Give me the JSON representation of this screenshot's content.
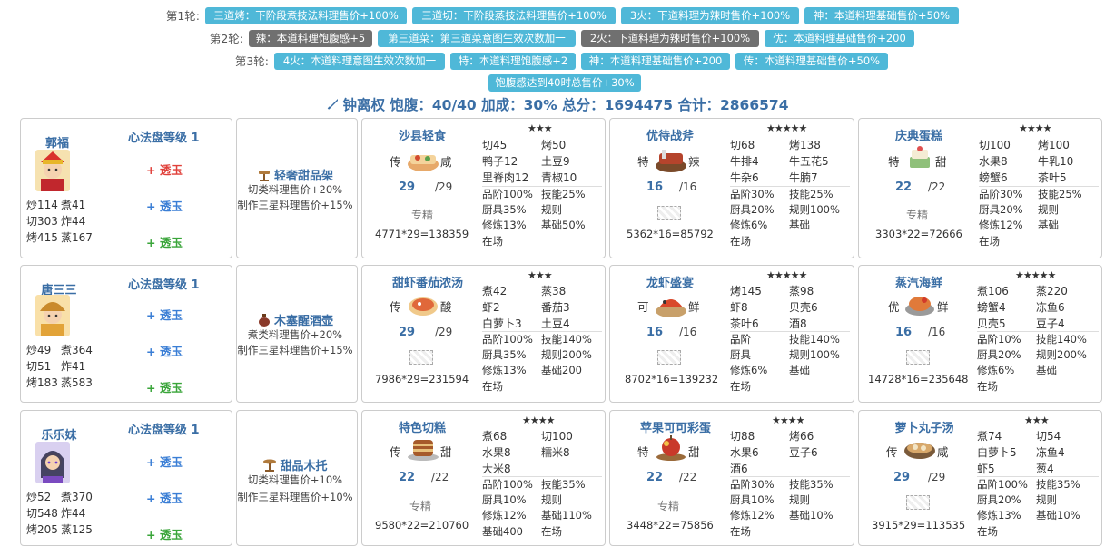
{
  "rounds": [
    {
      "label": "第1轮:",
      "tags": [
        {
          "text": "三道烤：下阶段煮技法料理售价+100%",
          "dark": false
        },
        {
          "text": "三道切：下阶段蒸技法料理售价+100%",
          "dark": false
        },
        {
          "text": "3火：下道料理为辣时售价+100%",
          "dark": false
        },
        {
          "text": "神：本道料理基础售价+50%",
          "dark": false
        }
      ]
    },
    {
      "label": "第2轮:",
      "tags": [
        {
          "text": "辣：本道料理饱腹感+5",
          "dark": true
        },
        {
          "text": "第三道菜：第三道菜意图生效次数加一",
          "dark": false
        },
        {
          "text": "2火：下道料理为辣时售价+100%",
          "dark": true
        },
        {
          "text": "优：本道料理基础售价+200",
          "dark": false
        }
      ]
    },
    {
      "label": "第3轮:",
      "tags": [
        {
          "text": "4火：本道料理意图生效次数加一",
          "dark": false
        },
        {
          "text": "特：本道料理饱腹感+2",
          "dark": false
        },
        {
          "text": "神：本道料理基础售价+200",
          "dark": false
        },
        {
          "text": "传：本道料理基础售价+50%",
          "dark": false
        }
      ]
    },
    {
      "label": "",
      "tags": [
        {
          "text": "饱腹感达到40时总售价+30%",
          "dark": false
        }
      ]
    }
  ],
  "summary": {
    "icon": "knife-icon",
    "text": "钟离权 饱腹：40/40 加成：30% 总分：1694475 合计：2866574"
  },
  "chefs": [
    {
      "name": "郭福",
      "heart_label": "心法盘等级 1",
      "jades": [
        {
          "label": "+ 透玉",
          "color": "#e0403a"
        },
        {
          "label": "+ 透玉",
          "color": "#3a7ed5"
        },
        {
          "label": "+ 透玉",
          "color": "#3aa53a"
        }
      ],
      "stats": [
        [
          "炒114",
          "煮41"
        ],
        [
          "切303",
          "炸44"
        ],
        [
          "烤415",
          "蒸167"
        ]
      ],
      "equip": {
        "name": "轻奢甜品架",
        "icon": "dessert-stand-icon",
        "effects": [
          "切类料理售价+20%",
          "制作三星料理售价+15%"
        ]
      },
      "recipes": [
        {
          "name": "沙县轻食",
          "stars": "★★★",
          "rank": "传",
          "taste": "咸",
          "qty": "29",
          "qty_max": "/29",
          "chef_label": "专精",
          "calc": "4771*29=138359",
          "mats": [
            [
              "切45",
              "烤50"
            ],
            [
              "鸭子12",
              "土豆9"
            ],
            [
              "里脊肉12",
              "青椒10"
            ]
          ],
          "grid": [
            [
              "品阶100%",
              "技能25%"
            ],
            [
              "厨具35%",
              "规则"
            ],
            [
              "修炼13%",
              "基础50%"
            ],
            [
              "在场",
              ""
            ]
          ]
        },
        {
          "name": "优待战斧",
          "stars": "★★★★★",
          "rank": "特",
          "taste": "辣",
          "qty": "16",
          "qty_max": "/16",
          "chef_label": "",
          "calc": "5362*16=85792",
          "mats": [
            [
              "切68",
              "烤138"
            ],
            [
              "牛排4",
              "牛五花5"
            ],
            [
              "牛杂6",
              "牛腩7"
            ]
          ],
          "grid": [
            [
              "品阶30%",
              "技能25%"
            ],
            [
              "厨具20%",
              "规则100%"
            ],
            [
              "修炼6%",
              "基础"
            ],
            [
              "在场",
              ""
            ]
          ]
        },
        {
          "name": "庆典蛋糕",
          "stars": "★★★★",
          "rank": "特",
          "taste": "甜",
          "qty": "22",
          "qty_max": "/22",
          "chef_label": "专精",
          "calc": "3303*22=72666",
          "mats": [
            [
              "切100",
              "烤100"
            ],
            [
              "水果8",
              "牛乳10"
            ],
            [
              "螃蟹6",
              "茶叶5"
            ]
          ],
          "grid": [
            [
              "品阶30%",
              "技能25%"
            ],
            [
              "厨具20%",
              "规则"
            ],
            [
              "修炼12%",
              "基础"
            ],
            [
              "在场",
              ""
            ]
          ]
        }
      ]
    },
    {
      "name": "唐三三",
      "heart_label": "心法盘等级 1",
      "jades": [
        {
          "label": "+ 透玉",
          "color": "#3a7ed5"
        },
        {
          "label": "+ 透玉",
          "color": "#3a7ed5"
        },
        {
          "label": "+ 透玉",
          "color": "#3aa53a"
        }
      ],
      "stats": [
        [
          "炒49",
          "煮364"
        ],
        [
          "切51",
          "炸41"
        ],
        [
          "烤183",
          "蒸583"
        ]
      ],
      "equip": {
        "name": "木塞醒酒壶",
        "icon": "wine-decanter-icon",
        "effects": [
          "煮类料理售价+20%",
          "制作三星料理售价+15%"
        ]
      },
      "recipes": [
        {
          "name": "甜虾番茄浓汤",
          "stars": "★★★",
          "rank": "传",
          "taste": "酸",
          "qty": "29",
          "qty_max": "/29",
          "chef_label": "",
          "calc": "7986*29=231594",
          "mats": [
            [
              "煮42",
              "蒸38"
            ],
            [
              "虾2",
              "番茄3"
            ],
            [
              "白萝卜3",
              "土豆4"
            ]
          ],
          "grid": [
            [
              "品阶100%",
              "技能140%"
            ],
            [
              "厨具35%",
              "规则200%"
            ],
            [
              "修炼13%",
              "基础200"
            ],
            [
              "在场",
              ""
            ]
          ]
        },
        {
          "name": "龙虾盛宴",
          "stars": "★★★★★",
          "rank": "可",
          "taste": "鲜",
          "qty": "16",
          "qty_max": "/16",
          "chef_label": "",
          "calc": "8702*16=139232",
          "mats": [
            [
              "烤145",
              "蒸98"
            ],
            [
              "虾8",
              "贝壳6"
            ],
            [
              "茶叶6",
              "酒8"
            ]
          ],
          "grid": [
            [
              "品阶",
              "技能140%"
            ],
            [
              "厨具",
              "规则100%"
            ],
            [
              "修炼6%",
              "基础"
            ],
            [
              "在场",
              ""
            ]
          ]
        },
        {
          "name": "蒸汽海鲜",
          "stars": "★★★★★",
          "rank": "优",
          "taste": "鲜",
          "qty": "16",
          "qty_max": "/16",
          "chef_label": "",
          "calc": "14728*16=235648",
          "mats": [
            [
              "煮106",
              "蒸220"
            ],
            [
              "螃蟹4",
              "冻鱼6"
            ],
            [
              "贝壳5",
              "豆子4"
            ]
          ],
          "grid": [
            [
              "品阶10%",
              "技能140%"
            ],
            [
              "厨具20%",
              "规则200%"
            ],
            [
              "修炼6%",
              "基础"
            ],
            [
              "在场",
              ""
            ]
          ]
        }
      ]
    },
    {
      "name": "乐乐妹",
      "heart_label": "心法盘等级 1",
      "jades": [
        {
          "label": "+ 透玉",
          "color": "#3a7ed5"
        },
        {
          "label": "+ 透玉",
          "color": "#3a7ed5"
        },
        {
          "label": "+ 透玉",
          "color": "#3aa53a"
        }
      ],
      "stats": [
        [
          "炒52",
          "煮370"
        ],
        [
          "切548",
          "炸44"
        ],
        [
          "烤205",
          "蒸125"
        ]
      ],
      "equip": {
        "name": "甜品木托",
        "icon": "wooden-tray-icon",
        "effects": [
          "切类料理售价+10%",
          "制作三星料理售价+10%"
        ]
      },
      "recipes": [
        {
          "name": "特色切糕",
          "stars": "★★★★",
          "rank": "传",
          "taste": "甜",
          "qty": "22",
          "qty_max": "/22",
          "chef_label": "专精",
          "calc": "9580*22=210760",
          "mats": [
            [
              "煮68",
              "切100"
            ],
            [
              "水果8",
              "糯米8"
            ],
            [
              "大米8",
              ""
            ]
          ],
          "grid": [
            [
              "品阶100%",
              "技能35%"
            ],
            [
              "厨具10%",
              "规则"
            ],
            [
              "修炼12%",
              "基础110%"
            ],
            [
              "基础400",
              "在场"
            ]
          ]
        },
        {
          "name": "苹果可可彩蛋",
          "stars": "★★★★",
          "rank": "特",
          "taste": "甜",
          "qty": "22",
          "qty_max": "/22",
          "chef_label": "专精",
          "calc": "3448*22=75856",
          "mats": [
            [
              "切88",
              "烤66"
            ],
            [
              "水果6",
              "豆子6"
            ],
            [
              "酒6",
              ""
            ]
          ],
          "grid": [
            [
              "品阶30%",
              "技能35%"
            ],
            [
              "厨具10%",
              "规则"
            ],
            [
              "修炼12%",
              "基础10%"
            ],
            [
              "在场",
              ""
            ]
          ]
        },
        {
          "name": "萝卜丸子汤",
          "stars": "★★★",
          "rank": "传",
          "taste": "咸",
          "qty": "29",
          "qty_max": "/29",
          "chef_label": "",
          "calc": "3915*29=113535",
          "mats": [
            [
              "煮74",
              "切54"
            ],
            [
              "白萝卜5",
              "冻鱼4"
            ],
            [
              "虾5",
              "葱4"
            ]
          ],
          "grid": [
            [
              "品阶100%",
              "技能35%"
            ],
            [
              "厨具20%",
              "规则"
            ],
            [
              "修炼13%",
              "基础10%"
            ],
            [
              "在场",
              ""
            ]
          ]
        }
      ]
    }
  ]
}
